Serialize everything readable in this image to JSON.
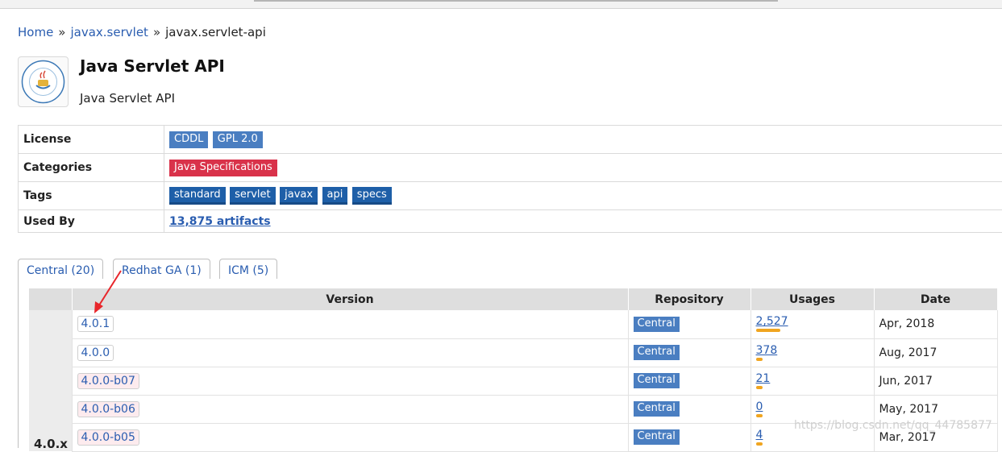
{
  "breadcrumb": {
    "home": "Home",
    "sep1": "»",
    "group": "javax.servlet",
    "sep2": "»",
    "current": "javax.servlet-api"
  },
  "artifact": {
    "title": "Java Servlet API",
    "description": "Java Servlet API",
    "logo_icon": "java-community-process-logo"
  },
  "info": {
    "license_label": "License",
    "licenses": [
      "CDDL",
      "GPL 2.0"
    ],
    "categories_label": "Categories",
    "categories": [
      "Java Specifications"
    ],
    "tags_label": "Tags",
    "tags": [
      "standard",
      "servlet",
      "javax",
      "api",
      "specs"
    ],
    "used_by_label": "Used By",
    "used_by": "13,875 artifacts"
  },
  "tabs": [
    "Central (20)",
    "Redhat GA (1)",
    "ICM (5)"
  ],
  "versions_table": {
    "headers": [
      "Version",
      "Repository",
      "Usages",
      "Date"
    ],
    "group_label": "4.0.x",
    "rows": [
      {
        "version": "4.0.1",
        "prerelease": false,
        "repository": "Central",
        "usages": "2,527",
        "usage_fraction": 1.0,
        "date": "Apr, 2018"
      },
      {
        "version": "4.0.0",
        "prerelease": false,
        "repository": "Central",
        "usages": "378",
        "usage_fraction": 0.15,
        "date": "Aug, 2017"
      },
      {
        "version": "4.0.0-b07",
        "prerelease": true,
        "repository": "Central",
        "usages": "21",
        "usage_fraction": 0.01,
        "date": "Jun, 2017"
      },
      {
        "version": "4.0.0-b06",
        "prerelease": true,
        "repository": "Central",
        "usages": "0",
        "usage_fraction": 0.0,
        "date": "May, 2017"
      },
      {
        "version": "4.0.0-b05",
        "prerelease": true,
        "repository": "Central",
        "usages": "4",
        "usage_fraction": 0.002,
        "date": "Mar, 2017"
      }
    ]
  },
  "watermark": "https://blog.csdn.net/qq_44785877",
  "colors": {
    "link": "#2a5db0",
    "license_badge": "#4a7ec1",
    "category_badge": "#d9324a",
    "tag_badge": "#1e5fa8",
    "usage_bar": "#f0a520",
    "annotation_arrow": "#e8262b"
  }
}
